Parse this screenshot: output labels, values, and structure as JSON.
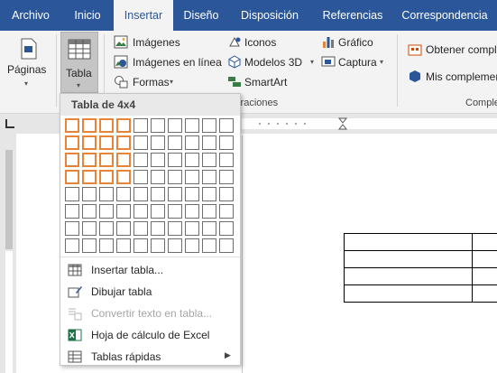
{
  "tabs": [
    {
      "label": "Archivo"
    },
    {
      "label": "Inicio"
    },
    {
      "label": "Insertar",
      "active": true
    },
    {
      "label": "Diseño"
    },
    {
      "label": "Disposición"
    },
    {
      "label": "Referencias"
    },
    {
      "label": "Correspondencia"
    }
  ],
  "ribbon": {
    "paginas": "Páginas",
    "tabla": "Tabla",
    "imagenes": "Imágenes",
    "imagenes_linea": "Imágenes en línea",
    "formas": "Formas",
    "iconos": "Iconos",
    "modelos3d": "Modelos 3D",
    "smartart": "SmartArt",
    "grafico": "Gráfico",
    "captura": "Captura",
    "obtener": "Obtener compl",
    "mis": "Mis complemen",
    "grp_ilustraciones": "straciones",
    "grp_complementos": "Comple"
  },
  "dropdown": {
    "header": "Tabla de 4x4",
    "grid": {
      "cols": 10,
      "rows": 8,
      "selected_cols": 4,
      "selected_rows": 4
    },
    "items": [
      {
        "label": "Insertar tabla...",
        "icon": "insert-table-icon",
        "enabled": true
      },
      {
        "label": "Dibujar tabla",
        "icon": "draw-table-icon",
        "enabled": true
      },
      {
        "label": "Convertir texto en tabla...",
        "icon": "convert-text-icon",
        "enabled": false
      },
      {
        "label": "Hoja de cálculo de Excel",
        "icon": "excel-icon",
        "enabled": true
      },
      {
        "label": "Tablas rápidas",
        "icon": "quick-tables-icon",
        "enabled": true,
        "submenu": true
      }
    ]
  },
  "colors": {
    "brand": "#2b579a",
    "selection": "#e8833a",
    "excel": "#1e7145"
  }
}
